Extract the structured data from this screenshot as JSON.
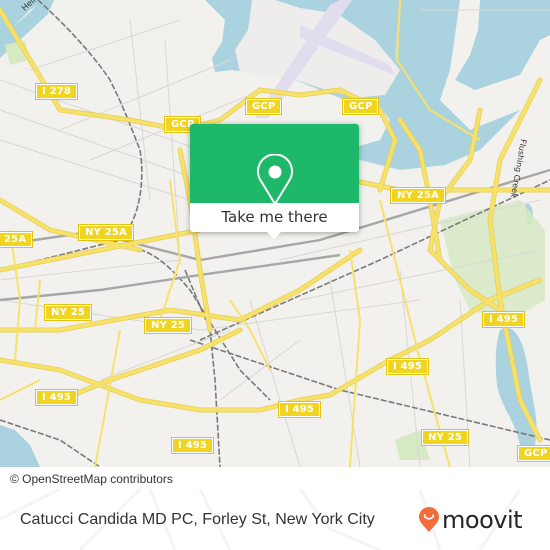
{
  "map": {
    "water_color": "#aad3df",
    "land_color": "#f2f1ee",
    "park_color": "#cfe6b8",
    "motorway_color": "#f7e269",
    "rail_color": "#777777",
    "shields": [
      {
        "id": "i278",
        "label": "I 278"
      },
      {
        "id": "gcp-west",
        "label": "GCP"
      },
      {
        "id": "gcp-mid",
        "label": "GCP"
      },
      {
        "id": "gcp-east",
        "label": "GCP"
      },
      {
        "id": "ny25a-west",
        "label": "25A"
      },
      {
        "id": "ny25a-mid",
        "label": "NY 25A"
      },
      {
        "id": "ny25a-east",
        "label": "NY 25A"
      },
      {
        "id": "ny25-west",
        "label": "NY 25"
      },
      {
        "id": "ny25-mid",
        "label": "NY 25"
      },
      {
        "id": "ny25-east",
        "label": "NY 25"
      },
      {
        "id": "i495-west",
        "label": "I 495"
      },
      {
        "id": "i495-south",
        "label": "I 495"
      },
      {
        "id": "i495-center",
        "label": "I 495"
      },
      {
        "id": "i495-mid",
        "label": "I 495"
      },
      {
        "id": "i495-east",
        "label": "I 495"
      },
      {
        "id": "gcp-southeast",
        "label": "GCP"
      }
    ],
    "road_labels": [
      {
        "id": "hell-gate",
        "label": "Hell Gate"
      },
      {
        "id": "flushing-creek",
        "label": "Flushing Creek"
      }
    ]
  },
  "popup": {
    "brand_color": "#1db86a",
    "pin_icon": "map-pin-icon",
    "button_label": "Take me there"
  },
  "attribution": "© OpenStreetMap contributors",
  "footer": {
    "title": "Catucci Candida MD PC, Forley St, New York City",
    "brand": "moovit",
    "brand_color": "#f26b3a",
    "logo_icon": "moovit-pin-smile-icon"
  }
}
